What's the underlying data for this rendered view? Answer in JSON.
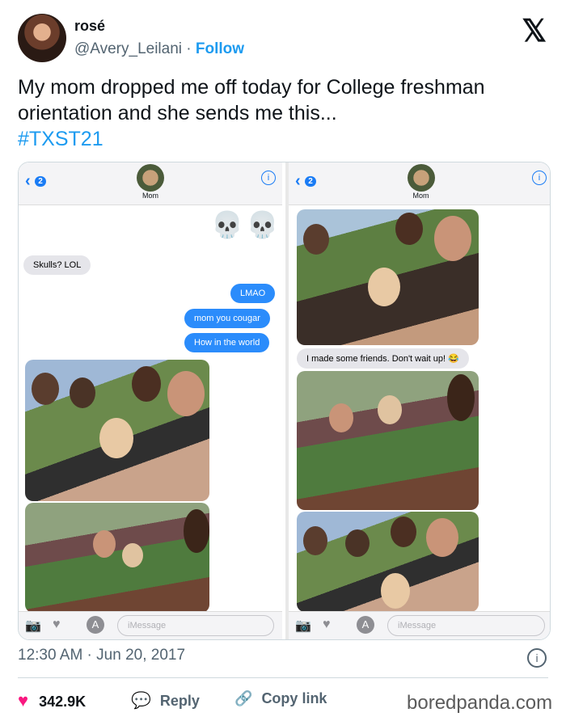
{
  "author": {
    "name": "rosé",
    "handle": "@Avery_Leilani",
    "separator": "·",
    "follow_label": "Follow"
  },
  "tweet": {
    "text": "My mom dropped me off today for College freshman orientation and she sends me this...",
    "hashtag": "#TXST21"
  },
  "screenshot_left": {
    "back_badge": "2",
    "contact_name": "Mom",
    "skulls": "💀💀",
    "messages": [
      {
        "from": "mom",
        "text": "Skulls? LOL"
      },
      {
        "from": "me",
        "text": "LMAO"
      },
      {
        "from": "me",
        "text": "mom you cougar"
      },
      {
        "from": "me",
        "text": "How in the world"
      }
    ],
    "input_placeholder": "iMessage"
  },
  "screenshot_right": {
    "back_badge": "2",
    "contact_name": "Mom",
    "caption": "I made some friends. Don't wait up! 😂",
    "input_placeholder": "iMessage"
  },
  "footer": {
    "timestamp": "12:30 AM · Jun 20, 2017",
    "likes": "342.9K",
    "reply_label": "Reply",
    "copy_label": "Copy link",
    "brand": "boredpanda.com"
  }
}
